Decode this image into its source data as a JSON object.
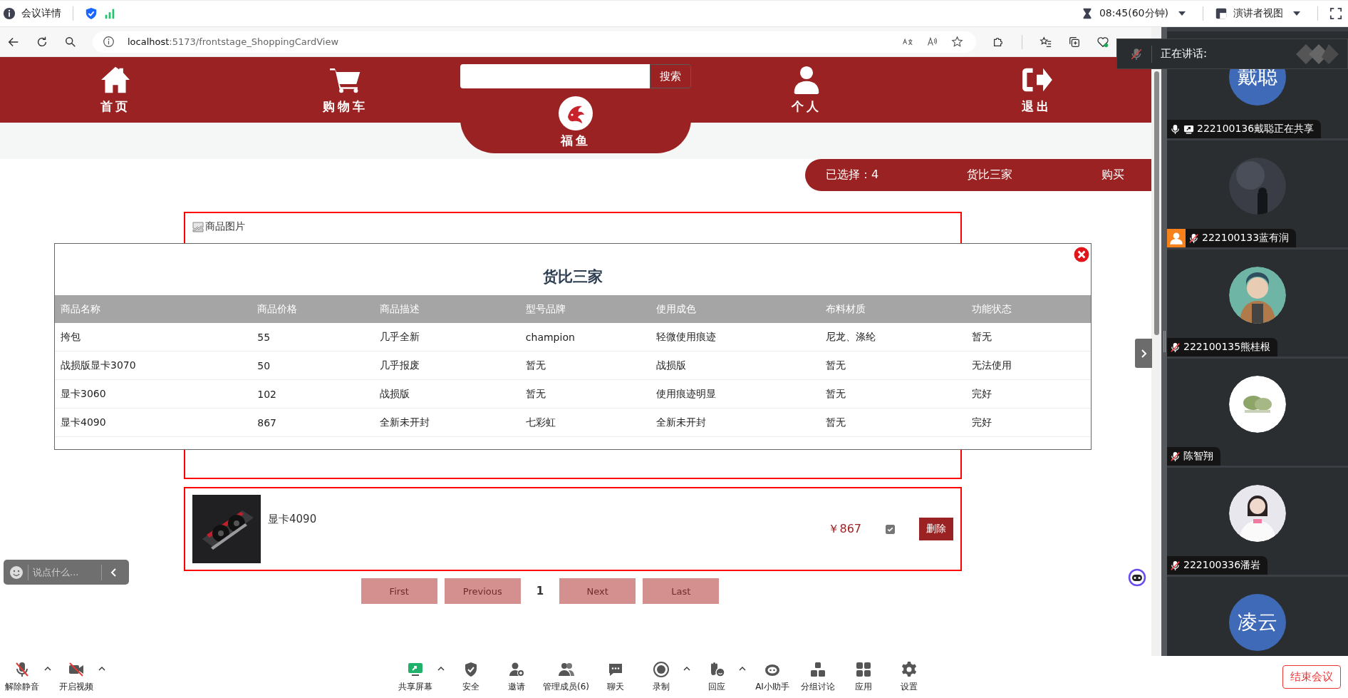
{
  "meeting_bar": {
    "title": "会议详情",
    "timer": "08:45(60分钟)",
    "view": "演讲者视图"
  },
  "browser": {
    "url": "**localhost**:5173/frontstage_ShoppingCardView"
  },
  "nav": {
    "items": [
      {
        "label": "首页",
        "kind": "home"
      },
      {
        "label": "购物车",
        "kind": "cart"
      },
      {
        "label": "个人",
        "kind": "person"
      },
      {
        "label": "退出",
        "kind": "exit"
      }
    ],
    "search_button": "搜索",
    "logo_label": "福鱼"
  },
  "selection_bar": {
    "selected": "已选择：4",
    "compare": "货比三家",
    "buy": "购买"
  },
  "cart_items": [
    {
      "kind": "broken",
      "image_alt": "商品图片"
    },
    {
      "name": "显卡4090",
      "price": "￥867",
      "checked": true,
      "delete": "删除"
    }
  ],
  "pagination": [
    {
      "label": "First",
      "selected": false
    },
    {
      "label": "Previous",
      "selected": false
    },
    {
      "label": "1",
      "selected": true
    },
    {
      "label": "Next",
      "selected": false
    },
    {
      "label": "Last",
      "selected": false
    }
  ],
  "modal": {
    "title": "货比三家",
    "columns": [
      "商品名称",
      "商品价格",
      "商品描述",
      "型号品牌",
      "使用成色",
      "布料材质",
      "功能状态"
    ],
    "rows": [
      [
        "挎包",
        "55",
        "几乎全新",
        "champion",
        "轻微使用痕迹",
        "尼龙、涤纶",
        "暂无"
      ],
      [
        "战损版显卡3070",
        "50",
        "几乎报废",
        "暂无",
        "战损版",
        "暂无",
        "无法使用"
      ],
      [
        "显卡3060",
        "102",
        "战损版",
        "暂无",
        "使用痕迹明显",
        "暂无",
        "完好"
      ],
      [
        "显卡4090",
        "867",
        "全新未开封",
        "七彩虹",
        "全新未开封",
        "暂无",
        "完好"
      ]
    ]
  },
  "chat": {
    "placeholder": "说点什么..."
  },
  "speaking": {
    "label": "正在讲话:"
  },
  "participants": [
    {
      "avatar": {
        "kind": "text",
        "text": "戴聪"
      },
      "name": "222100136戴聪正在共享",
      "muted": false,
      "sharing": true,
      "host": false
    },
    {
      "name": "222100133蓝有润",
      "muted": true,
      "sharing": false,
      "host": true
    },
    {
      "name": "222100135熊桂根",
      "muted": true,
      "sharing": false,
      "host": false
    },
    {
      "name": "陈智翔",
      "muted": true,
      "sharing": false,
      "host": false
    },
    {
      "name": "222100336潘岩",
      "muted": true,
      "sharing": false,
      "host": false
    },
    {
      "avatar": {
        "kind": "text",
        "text": "凌云"
      }
    }
  ],
  "toolbar_left": [
    {
      "label": "解除静音",
      "kind": "mic-off",
      "caret": true
    },
    {
      "label": "开启视频",
      "kind": "video-off",
      "caret": true
    }
  ],
  "toolbar_center": [
    {
      "label": "共享屏幕",
      "kind": "share",
      "caret": true
    },
    {
      "label": "安全",
      "kind": "shield",
      "caret": false
    },
    {
      "label": "邀请",
      "kind": "invite",
      "caret": false
    },
    {
      "label": "管理成员(6)",
      "kind": "members",
      "caret": false
    },
    {
      "label": "聊天",
      "kind": "chat",
      "caret": false
    },
    {
      "label": "录制",
      "kind": "record",
      "caret": true
    },
    {
      "label": "回应",
      "kind": "react",
      "caret": true
    },
    {
      "label": "AI小助手",
      "kind": "bot",
      "caret": false
    },
    {
      "label": "分组讨论",
      "kind": "groups",
      "caret": false
    },
    {
      "label": "应用",
      "kind": "apps",
      "caret": false
    },
    {
      "label": "设置",
      "kind": "settings",
      "caret": false
    }
  ],
  "end_button": "结束会议"
}
